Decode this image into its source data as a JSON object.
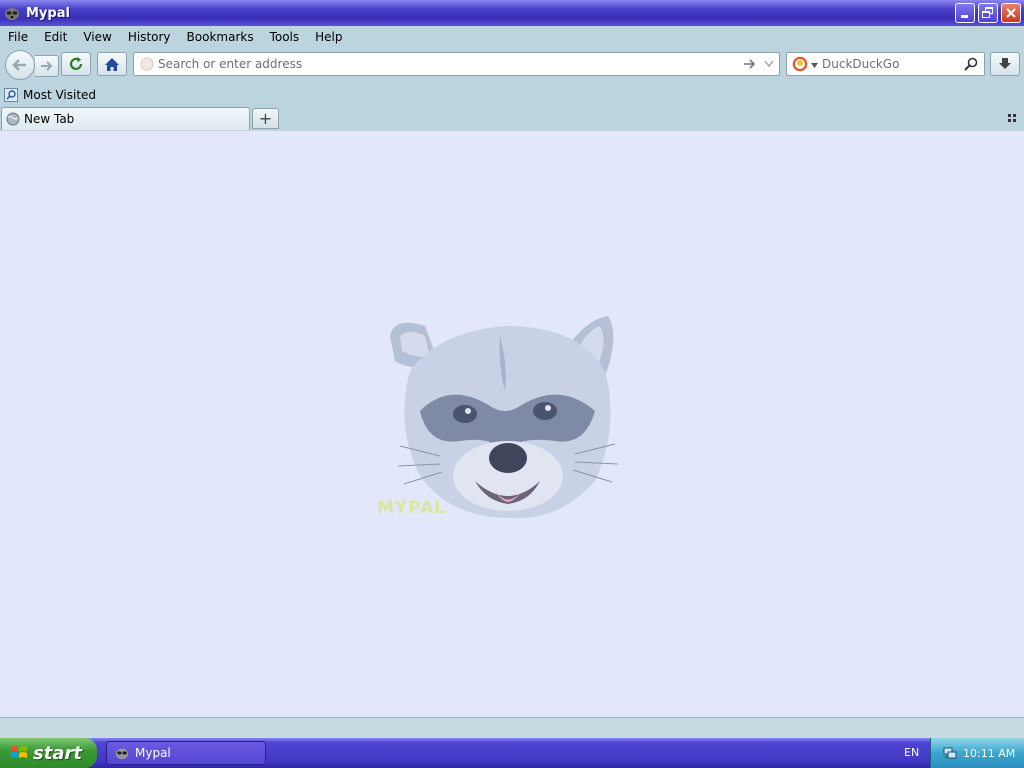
{
  "window": {
    "title": "Mypal",
    "app_icon": "raccoon-icon"
  },
  "menu": {
    "items": [
      {
        "label": "File"
      },
      {
        "label": "Edit"
      },
      {
        "label": "View"
      },
      {
        "label": "History"
      },
      {
        "label": "Bookmarks"
      },
      {
        "label": "Tools"
      },
      {
        "label": "Help"
      }
    ]
  },
  "navbar": {
    "url_placeholder": "Search or enter address",
    "url_value": "",
    "search_engine": "DuckDuckGo",
    "search_placeholder": "DuckDuckGo"
  },
  "bookmarks": {
    "items": [
      {
        "label": "Most Visited",
        "icon": "most-visited-icon"
      }
    ]
  },
  "tabs": [
    {
      "label": "New Tab",
      "active": true
    }
  ],
  "page": {
    "logo_text": "MYPAL"
  },
  "taskbar": {
    "start_label": "start",
    "tasks": [
      {
        "label": "Mypal"
      }
    ],
    "language": "EN",
    "clock": "10:11 AM"
  },
  "colors": {
    "titlebar": "#4a40c8",
    "chrome": "#bcd4dd",
    "content_bg": "#e3e7fb",
    "start_green": "#3d9a38"
  }
}
